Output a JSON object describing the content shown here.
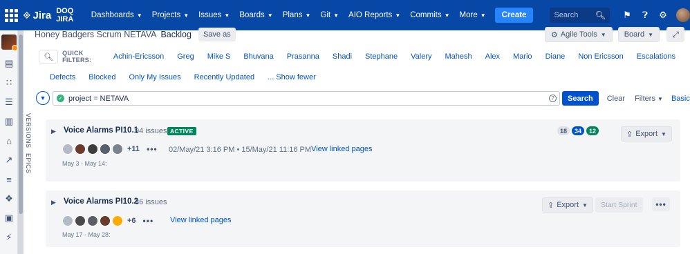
{
  "topnav": {
    "brand": "Jira",
    "site": "DOQ JIRA",
    "items": [
      {
        "label": "Dashboards"
      },
      {
        "label": "Projects"
      },
      {
        "label": "Issues"
      },
      {
        "label": "Boards"
      },
      {
        "label": "Plans"
      },
      {
        "label": "Git"
      },
      {
        "label": "AIO Reports"
      },
      {
        "label": "Commits"
      },
      {
        "label": "More"
      }
    ],
    "create_label": "Create",
    "search_placeholder": "Search",
    "colors": {
      "bar": "#0747a6",
      "create": "#2684ff"
    }
  },
  "sidebar": {
    "icons": [
      "backlog-icon",
      "hierarchy-icon",
      "list-icon",
      "board-icon",
      "release-icon",
      "reports-icon",
      "issues-icon",
      "components-icon",
      "pages-icon",
      "shortcuts-icon"
    ]
  },
  "header": {
    "project_name": "Honey Badgers Scrum NETAVA",
    "board_name": "Backlog",
    "save_as": "Save as",
    "agile_tools": "Agile Tools",
    "board": "Board"
  },
  "quick_filters": {
    "label": "QUICK FILTERS:",
    "row1": [
      "Achin-Ericsson",
      "Greg",
      "Mike S",
      "Bhuvana",
      "Prasanna",
      "Shadi",
      "Stephane",
      "Valery",
      "Mahesh",
      "Alex",
      "Mario",
      "Diane",
      "Non Ericsson",
      "Escalations"
    ],
    "row2": [
      "Defects",
      "Blocked",
      "Only My Issues",
      "Recently Updated",
      "... Show fewer"
    ]
  },
  "jql": {
    "query": "project = NETAVA",
    "search": "Search",
    "clear": "Clear",
    "filters": "Filters",
    "basic": "Basic"
  },
  "side_tabs": {
    "versions": "VERSIONS",
    "epics": "EPICS"
  },
  "sprints": [
    {
      "name": "Voice Alarms PI10.1",
      "issues": "94 issues",
      "status": "ACTIVE",
      "more_assignees": "+11",
      "dates": "02/May/21 3:16 PM  •  15/May/21 11:16 PM",
      "linked": "View linked pages",
      "range": "May 3 - May 14:",
      "todo": "18",
      "in_progress": "34",
      "done": "12",
      "export": "Export"
    },
    {
      "name": "Voice Alarms PI10.2",
      "issues": "36 issues",
      "more_assignees": "+6",
      "linked": "View linked pages",
      "range": "May 17 - May 28:",
      "export": "Export",
      "start": "Start Sprint"
    }
  ]
}
